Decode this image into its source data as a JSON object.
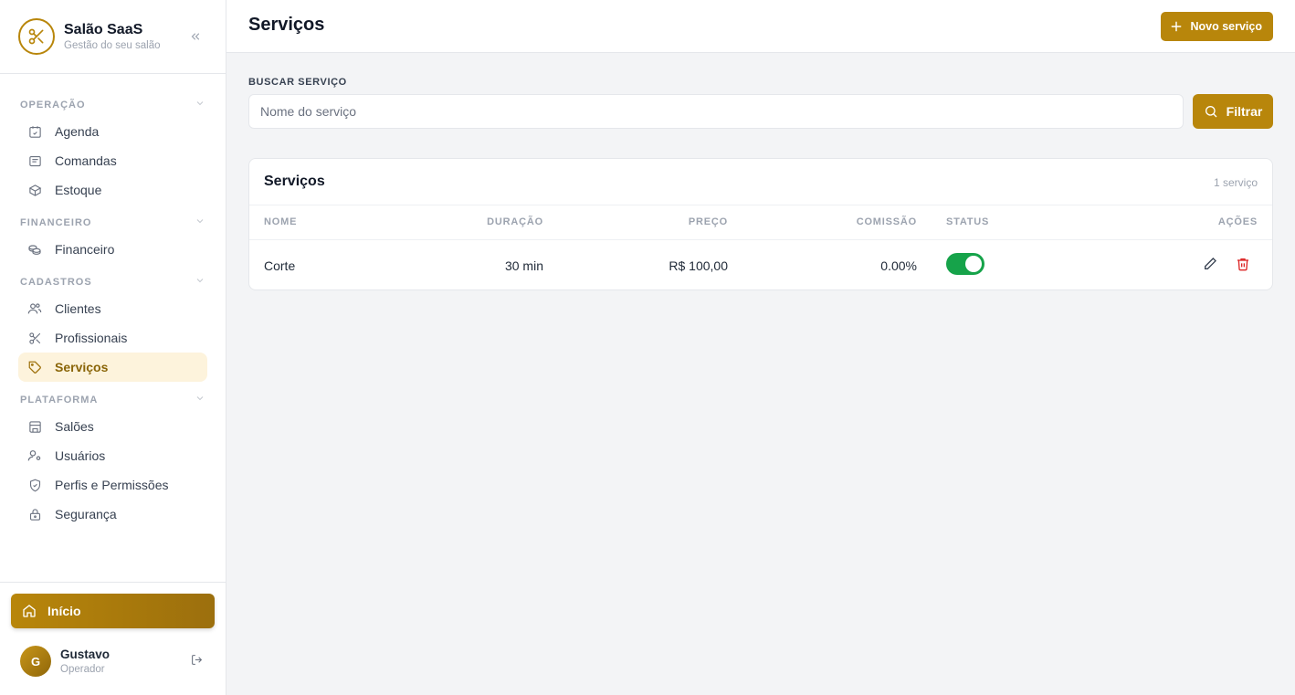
{
  "brand": {
    "title": "Salão SaaS",
    "subtitle": "Gestão do seu salão"
  },
  "nav": {
    "sections": [
      {
        "title": "OPERAÇÃO",
        "items": [
          {
            "label": "Agenda",
            "icon": "calendar-icon"
          },
          {
            "label": "Comandas",
            "icon": "receipt-icon"
          },
          {
            "label": "Estoque",
            "icon": "box-icon"
          }
        ]
      },
      {
        "title": "FINANCEIRO",
        "items": [
          {
            "label": "Financeiro",
            "icon": "coins-icon"
          }
        ]
      },
      {
        "title": "CADASTROS",
        "items": [
          {
            "label": "Clientes",
            "icon": "users-icon"
          },
          {
            "label": "Profissionais",
            "icon": "scissors-icon"
          },
          {
            "label": "Serviços",
            "icon": "tag-icon",
            "active": true
          }
        ]
      },
      {
        "title": "PLATAFORMA",
        "items": [
          {
            "label": "Salões",
            "icon": "store-icon"
          },
          {
            "label": "Usuários",
            "icon": "user-cog-icon"
          },
          {
            "label": "Perfis e Permissões",
            "icon": "shield-icon"
          },
          {
            "label": "Segurança",
            "icon": "lock-icon"
          }
        ]
      }
    ]
  },
  "home_label": "Início",
  "user": {
    "initial": "G",
    "name": "Gustavo",
    "role": "Operador"
  },
  "header": {
    "title": "Serviços",
    "new_button": "Novo serviço"
  },
  "search": {
    "label": "BUSCAR SERVIÇO",
    "placeholder": "Nome do serviço",
    "button": "Filtrar"
  },
  "table": {
    "title": "Serviços",
    "count": "1 serviço",
    "columns": {
      "name": "NOME",
      "duration": "DURAÇÃO",
      "price": "PREÇO",
      "commission": "COMISSÃO",
      "status": "STATUS",
      "actions": "AÇÕES"
    },
    "rows": [
      {
        "name": "Corte",
        "duration": "30 min",
        "price": "R$ 100,00",
        "commission": "0.00%",
        "status_active": true
      }
    ]
  },
  "colors": {
    "accent": "#b8860b",
    "active_bg": "#fdf3dc",
    "toggle_on": "#16a34a",
    "delete": "#dc2626"
  }
}
